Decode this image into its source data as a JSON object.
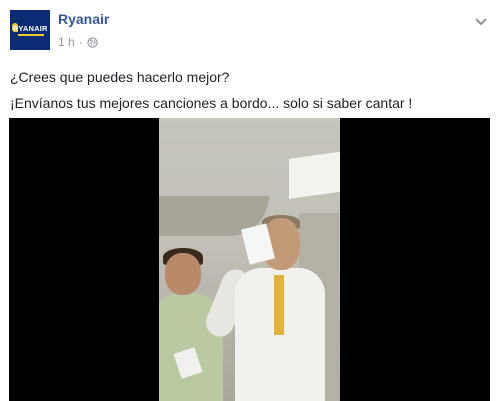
{
  "post": {
    "page_name": "Ryanair",
    "avatar_logo_text": "RYANAIR",
    "timestamp": "1 h",
    "separator": "·",
    "audience_icon": "globe-icon",
    "menu_icon": "chevron-down-icon",
    "text_lines": [
      "¿Crees que puedes hacerlo mejor?",
      "¡Envíanos tus mejores canciones a bordo... solo si saber cantar !"
    ]
  },
  "colors": {
    "page_name": "#365899",
    "meta": "#90949c",
    "text": "#1d2129",
    "brand_navy": "#0b2c74",
    "brand_yellow": "#f1c933",
    "video_bg": "#000000"
  }
}
